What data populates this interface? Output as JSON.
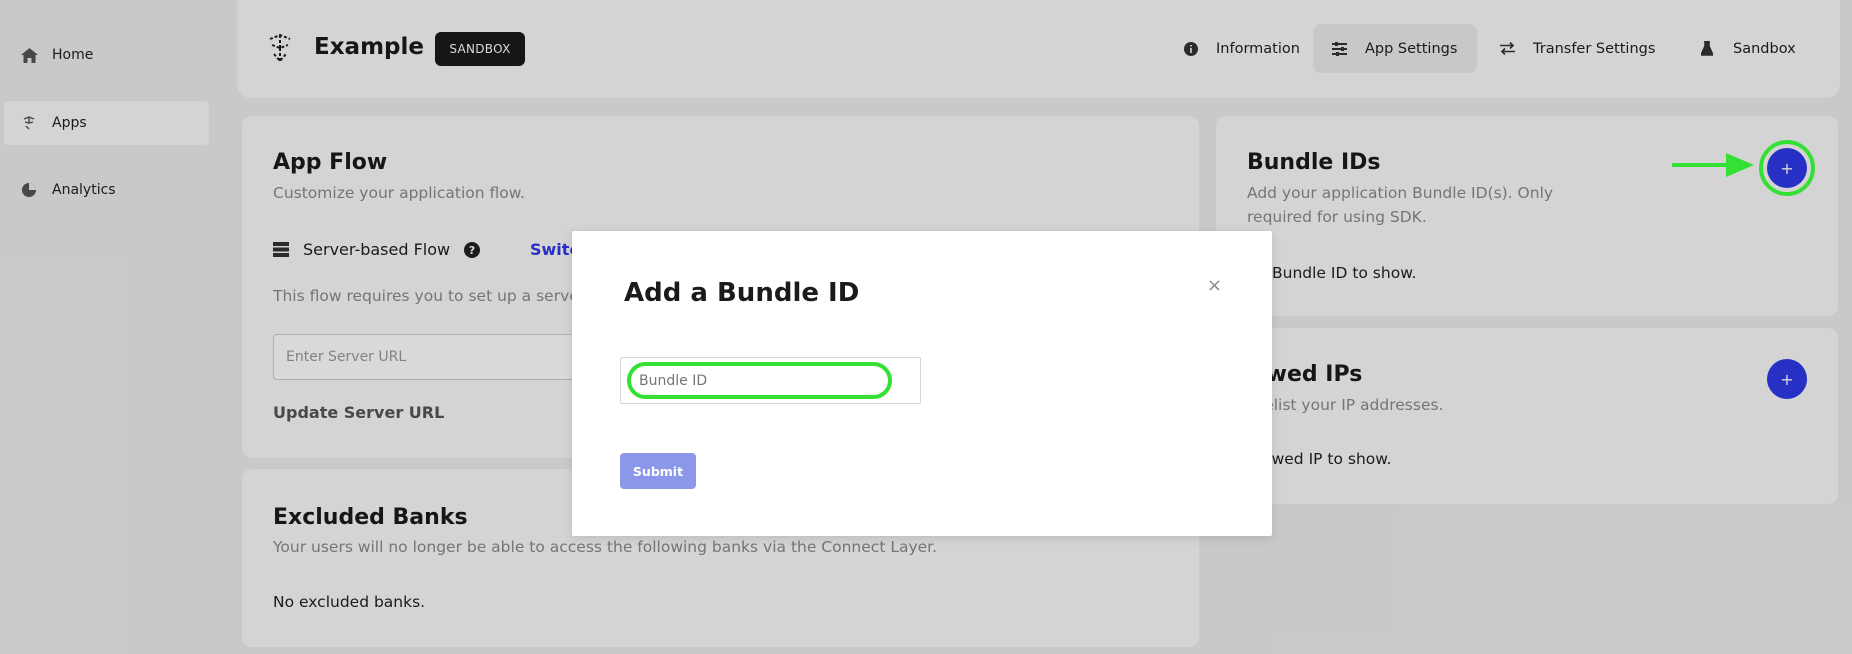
{
  "sidebar": {
    "items": [
      {
        "label": "Home",
        "icon": "home-icon"
      },
      {
        "label": "Apps",
        "icon": "apps-icon",
        "active": true
      },
      {
        "label": "Analytics",
        "icon": "pie-chart-icon"
      }
    ]
  },
  "header": {
    "app_name": "Example",
    "environment_badge": "SANDBOX",
    "nav": [
      {
        "label": "Information",
        "icon": "info-icon"
      },
      {
        "label": "App Settings",
        "icon": "sliders-icon",
        "active": true
      },
      {
        "label": "Transfer Settings",
        "icon": "transfer-icon"
      },
      {
        "label": "Sandbox",
        "icon": "flask-icon"
      }
    ]
  },
  "app_flow": {
    "title": "App Flow",
    "subtitle": "Customize your application flow.",
    "mode_label": "Server-based Flow",
    "switch_label": "Switch",
    "description": "This flow requires you to set up a server",
    "server_url_placeholder": "Enter Server URL",
    "update_label": "Update Server URL"
  },
  "excluded_banks": {
    "title": "Excluded Banks",
    "subtitle": "Your users will no longer be able to access the following banks via the Connect Layer.",
    "empty_text": "No excluded banks."
  },
  "bundle_ids": {
    "title": "Bundle IDs",
    "subtitle_line1": "Add your application Bundle ID(s). Only",
    "subtitle_line2": "required for using SDK.",
    "empty_text": "Bundle ID to show.",
    "add_label": "+"
  },
  "allowed_ips": {
    "title": "lowed IPs",
    "subtitle": "nitelist your IP addresses.",
    "empty_text": "allowed IP to show.",
    "add_label": "+"
  },
  "modal": {
    "title": "Add a Bundle ID",
    "close_label": "×",
    "bundle_id_placeholder": "Bundle ID",
    "submit_label": "Submit"
  },
  "colors": {
    "accent": "#2d39e8",
    "highlight": "#33e033",
    "submit_disabled": "#8b98e9"
  }
}
